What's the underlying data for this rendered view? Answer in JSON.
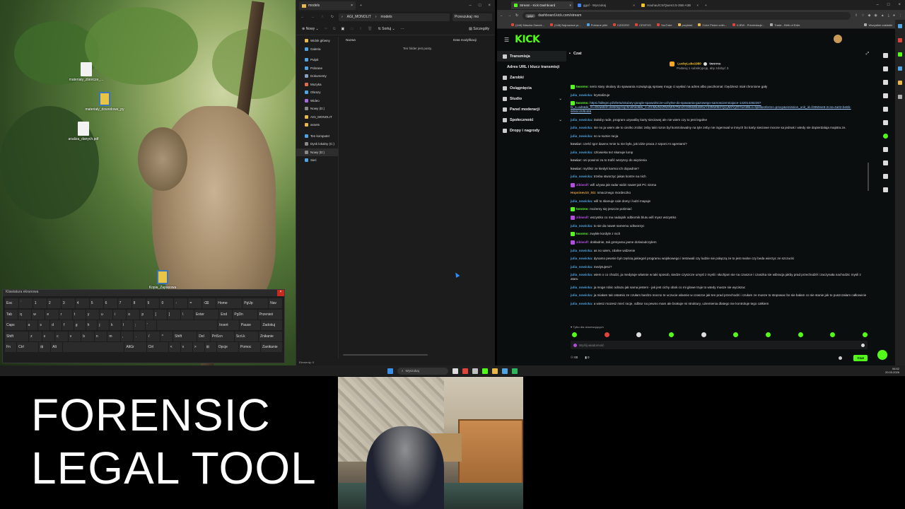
{
  "desktop": {
    "icons": [
      {
        "label": "materiały_zbiorcze_...",
        "kind": "doc"
      },
      {
        "label": "materiały_dowodowe_py",
        "kind": "py"
      },
      {
        "label": "analiza_danych.pdf",
        "kind": "doc"
      },
      {
        "label": "Kopia_Zapasowa",
        "kind": "py"
      }
    ]
  },
  "osk": {
    "title": "Klawiatura ekranowa",
    "rows": [
      [
        "Esc",
        "`",
        "1",
        "2",
        "3",
        "4",
        "5",
        "6",
        "7",
        "8",
        "9",
        "0",
        "-",
        "=",
        "⌫",
        "Home",
        "PgUp",
        "Nav"
      ],
      [
        "Tab",
        "q",
        "w",
        "e",
        "r",
        "t",
        "y",
        "u",
        "i",
        "o",
        "p",
        "[",
        "]",
        "\\",
        "Enter",
        "End",
        "PgDn",
        "Przenieś"
      ],
      [
        "Caps",
        "a",
        "s",
        "d",
        "f",
        "g",
        "h",
        "j",
        "k",
        "l",
        ";",
        "'",
        "",
        "Insert",
        "Pause",
        "Zadokuj"
      ],
      [
        "Shift",
        "z",
        "x",
        "c",
        "v",
        "b",
        "n",
        "m",
        ",",
        ".",
        "/",
        "^",
        "Shift",
        "Del",
        "PrtScn",
        "ScrLk",
        "Znikanie"
      ],
      [
        "Fn",
        "Ctrl",
        "⊞",
        "Alt",
        "",
        "AltGr",
        "Ctrl",
        "<",
        "v",
        ">",
        "⊞",
        "Opcje",
        "Pomoc",
        "Zanikanie"
      ]
    ]
  },
  "explorer": {
    "tab_title": "models",
    "breadcrumb": [
      "AGI_MONOLIT",
      "models"
    ],
    "search_placeholder": "Przeszukaj: mo",
    "new_label": "Nowy",
    "sort_label": "Sortuj",
    "view_label": "Szczegóły",
    "nav": [
      {
        "label": "Widok główny",
        "color": "#e8b84a"
      },
      {
        "label": "Galeria",
        "color": "#4fa3e0"
      },
      {
        "label": "",
        "color": ""
      },
      {
        "label": "Pulpit",
        "color": "#4fa3e0"
      },
      {
        "label": "Pobrane",
        "color": "#4fa3e0"
      },
      {
        "label": "Dokumenty",
        "color": "#8aa0c0"
      },
      {
        "label": "Muzyka",
        "color": "#e06c4f"
      },
      {
        "label": "Obrazy",
        "color": "#4fa3e0"
      },
      {
        "label": "Wideo",
        "color": "#a06ce0"
      },
      {
        "label": "Nowy (D:)",
        "color": "#888888"
      },
      {
        "label": "AGI_MONOLIT",
        "color": "#e8b84a"
      },
      {
        "label": "assets",
        "color": "#e8b84a"
      },
      {
        "label": "",
        "color": ""
      },
      {
        "label": "Ten komputer",
        "color": "#4fa3e0"
      },
      {
        "label": "Dysk lokalny (C:)",
        "color": "#888888"
      },
      {
        "label": "Nowy (D:)",
        "color": "#888888"
      },
      {
        "label": "Sieć",
        "color": "#4fa3e0"
      }
    ],
    "columns": [
      "Nazwa",
      "Data modyfikacji"
    ],
    "empty_message": "Ten folder jest pusty.",
    "status": "Elementy: 0"
  },
  "browser": {
    "tabs": [
      {
        "label": "Stream - Kick Dashboard",
        "color": "#53fc18",
        "active": true
      },
      {
        "label": "gguf - Wyszukaj",
        "color": "#4285f4",
        "active": false
      },
      {
        "label": "Hauhau/CS/Qwen3.5-35B-A3B",
        "color": "#f5c518",
        "active": false
      }
    ],
    "url": "dashboard.kick.com/stream",
    "url_badge": "gdpr",
    "bookmarks": [
      {
        "label": "(146) Maszka Zamek...",
        "color": "#e0443a"
      },
      {
        "label": "(148) Najnowsze pr...",
        "color": "#e0443a"
      },
      {
        "label": "Pobrane pliki",
        "color": "#4fa3e0"
      },
      {
        "label": "CZODRO",
        "color": "#e0443a"
      },
      {
        "label": "CENTOS",
        "color": "#e0443a"
      },
      {
        "label": "YouTube",
        "color": "#e0443a"
      },
      {
        "label": "przykład",
        "color": "#e8b84a"
      },
      {
        "label": "Color Picker onlin...",
        "color": "#e8b84a"
      },
      {
        "label": "KJEW - Prezentacje...",
        "color": "#e0443a"
      },
      {
        "label": "Trade - Birth of Exile",
        "color": "#aaaaaa"
      },
      {
        "label": "Wszystkie zakładki",
        "color": "#aaaaaa"
      }
    ]
  },
  "kick": {
    "logo": "KICK",
    "sidebar": [
      {
        "label": "Transmisja",
        "sub": false,
        "chevron": "",
        "active": true
      },
      {
        "label": "Adres URL i klucz transmisji",
        "sub": true,
        "chevron": "",
        "active": false
      },
      {
        "label": "Zarobki",
        "sub": false,
        "chevron": "",
        "active": false
      },
      {
        "label": "Osiągnięcia",
        "sub": false,
        "chevron": "",
        "active": false
      },
      {
        "label": "Studio",
        "sub": false,
        "chevron": "⌄",
        "active": false
      },
      {
        "label": "Panel moderacji",
        "sub": false,
        "chevron": "",
        "active": false
      },
      {
        "label": "Społeczność",
        "sub": false,
        "chevron": "⌄",
        "active": false
      },
      {
        "label": "Dropy i nagrody",
        "sub": false,
        "chevron": "",
        "active": false
      }
    ],
    "chat_title": "Czat",
    "pinned": {
      "user1": "LuckyLuke1980",
      "user2": "tworms",
      "subtext": "Podaruj 1 subskrypcję, aby zdobyć 3."
    },
    "messages": [
      {
        "user": "tworms:",
        "color": "#53fc18",
        "badge": true,
        "text": "serio stary okulary do spawania rozwiązują sprawę mogę ci wysłać na adres albo paczkomat i będziesz miał chronione gały"
      },
      {
        "user": "julia_nowicka:",
        "color": "#4fa3e0",
        "badge": false,
        "text": "krystalizuje"
      },
      {
        "user": "tworms:",
        "color": "#53fc18",
        "badge": true,
        "link": "https://allegro.pl/oferta/okulary-google-spawalnicze-uchylne-do-spawania-gazowego-samosciemniajace-14201436226?bi_s=ads&bi_m=showitem:desktop:top:finished&bi_c=ZmMwNzZfMzMtNTNmZC00MdtlLWEwY2ItNWM4YjUyM2YjZ0YwAiBiLx=spel&referrer=proxy&emission_unit_id=f4950ee8-2c4a-4a02-be6b-9060c05f8488"
      },
      {
        "user": "julia_nowicka:",
        "color": "#4fa3e0",
        "badge": false,
        "text": "Dałoby rade, program uzywalby karty sieciowej ale nie wiem czy to jest legalne"
      },
      {
        "user": "julia_nowicka:",
        "color": "#4fa3e0",
        "badge": false,
        "text": "nie no ja wiem ale to ciezko zrobic zeby taki rozon byl kontrolowalny na tyle zeby nie ingerowal w innych bo karty sieciowe mocne sa jednak i wtedy sie dopierdalaja majstra.ze."
      },
      {
        "user": "julia_nowicka:",
        "color": "#4fa3e0",
        "badge": false,
        "text": "no w sumie racja"
      },
      {
        "user": "kowiar:",
        "color": "#c0c0c0",
        "badge": false,
        "text": "cześć Igor dawno mnie tu nie było, jak idzie praca z szponi AI agentami?"
      },
      {
        "user": "julia_nowicka:",
        "color": "#4fa3e0",
        "badge": false,
        "text": "czlowieka tez skanuje lump"
      },
      {
        "user": "kowiar:",
        "color": "#c0c0c0",
        "badge": false,
        "text": "oni powinni za to trafić wszyscy do więzienia"
      },
      {
        "user": "kowiar:",
        "color": "#c0c0c0",
        "badge": false,
        "text": "myślisz ze kiedyś karma ich dopadnie?"
      },
      {
        "user": "julia_nowicka:",
        "color": "#4fa3e0",
        "badge": false,
        "text": "trzeba stworzyc jakas kontre na nich"
      },
      {
        "user": "zibiwolf:",
        "color": "#b44ce0",
        "badge": true,
        "text": "wifi używa jak radar widzi nawet jak PC nisma"
      },
      {
        "user": "Hopsinev10_SG:",
        "color": "#e0a03a",
        "badge": false,
        "text": "smacznego mordeczko"
      },
      {
        "user": "julia_nowicka:",
        "color": "#4fa3e0",
        "badge": false,
        "text": "wifi to skanuje cale domy i ludzi mapuje"
      },
      {
        "user": "tworms:",
        "color": "#53fc18",
        "badge": true,
        "text": "możemy się jeszcze pośmiać"
      },
      {
        "user": "zibiwolf:",
        "color": "#b44ce0",
        "badge": true,
        "text": "wszystko co ma nadajnik odbiornik blutu wifi mysz wszystko"
      },
      {
        "user": "julia_nowicka:",
        "color": "#4fa3e0",
        "badge": false,
        "text": "to sie da nawet samemu odtworzyc"
      },
      {
        "user": "tworms:",
        "color": "#53fc18",
        "badge": true,
        "text": "zwykłe kordyle z nich"
      },
      {
        "user": "zibiwolf:",
        "color": "#b44ce0",
        "badge": true,
        "text": "dokładnie, tak gresywna jasne doświadczyłem"
      },
      {
        "user": "julia_nowicka:",
        "color": "#4fa3e0",
        "badge": false,
        "text": "as no wiem, zdalne widzenie"
      },
      {
        "user": "julia_nowicka:",
        "color": "#4fa3e0",
        "badge": false,
        "text": "dynamo pewnie był częścią jakiegoś programu wojskowego i testowali czy ludzie sie połączą ze to jest realne czy beda wierzyc ze szczucki"
      },
      {
        "user": "julia_nowicka:",
        "color": "#4fa3e0",
        "badge": false,
        "text": "medytujesz?"
      },
      {
        "user": "julia_nowicka:",
        "color": "#4fa3e0",
        "badge": false,
        "text": "wiem o co chodzi, ja medytuje wlasnie w taki sposob, siedze czyszcze umysl z mysli i słuchjam sie na czaszce i czaszka sie wibracja jakby prad przechodził i zaczynała nachodzic mysli z ataru"
      },
      {
        "user": "julia_nowicka:",
        "color": "#4fa3e0",
        "badge": false,
        "text": "ja moge robic odrazu jak sama jestem - jak jest cichy obok co mi glowe truje to wtedy musze sie wyciszac"
      },
      {
        "user": "julia_nowicka:",
        "color": "#4fa3e0",
        "badge": false,
        "text": "ja miałam tak ostatnio ze czułam bardzo mocno te uczucie wlasnie w czaszce jak ten prad przechodzi i czułam ze musze to stopowac bo sie bałam co sie stanie jak to puszczałam całkowicie"
      },
      {
        "user": "julia_nowicka:",
        "color": "#4fa3e0",
        "badge": false,
        "text": "a wiesz mozesz mieć racje, odbior na pewno mam ale brakuje mi struktury, uziemienia dlatego nie kontroluje tego całkiem"
      }
    ],
    "followers_note": "Tylko dla obserwujących",
    "input_placeholder": "Wyślij wiadomość",
    "viewer_count": "00",
    "points": "0",
    "chat_button": "Czat"
  },
  "taskbar": {
    "search_placeholder": "Wyszukaj",
    "time": "06:52",
    "date": "20.03.2026"
  },
  "overlay": {
    "line1": "FORENSIC",
    "line2": "LEGAL TOOL"
  }
}
